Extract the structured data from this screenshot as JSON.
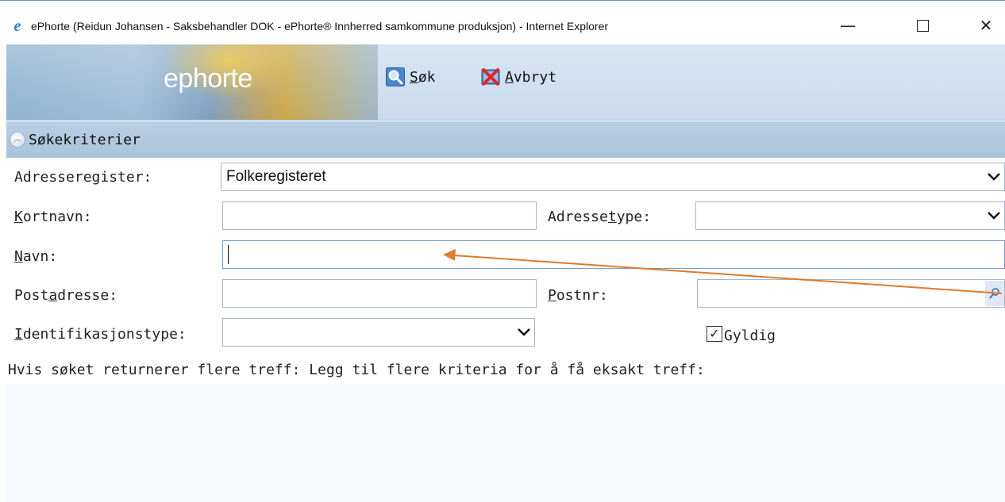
{
  "window": {
    "title": "ePhorte (Reidun Johansen - Saksbehandler DOK - ePhorte® Innherred samkommune produksjon) - Internet Explorer",
    "min_glyph": "—",
    "close_glyph": "✕"
  },
  "header": {
    "logo_text": "ephorte",
    "search_button": {
      "first": "S",
      "rest": "øk"
    },
    "cancel_button": {
      "first": "A",
      "rest": "vbryt"
    }
  },
  "section": {
    "title": "Søkekriterier"
  },
  "form": {
    "adresseregister": {
      "label": "Adresseregister:",
      "value": "Folkeregisteret"
    },
    "kortnavn": {
      "label_u": "K",
      "label_rest": "ortnavn:",
      "value": ""
    },
    "adressetype": {
      "label_pre": "Adresse",
      "label_u": "t",
      "label_rest": "ype:",
      "value": ""
    },
    "navn": {
      "label_u": "N",
      "label_rest": "avn:",
      "value": ""
    },
    "postadresse": {
      "label_pre": "Post",
      "label_u": "a",
      "label_rest": "dresse:",
      "value": ""
    },
    "postnr": {
      "label_u": "P",
      "label_rest": "ostnr:",
      "value": ""
    },
    "identifikasjonstype": {
      "label_u": "I",
      "label_rest": "dentifikasjonstype:",
      "value": ""
    },
    "gyldig": {
      "label": "Gyldig",
      "checked": true,
      "check_glyph": "✓"
    }
  },
  "hint": "Hvis søket returnerer flere treff: Legg til flere kriteria for å få eksakt treff:",
  "colors": {
    "annotation_arrow": "#e07a2c",
    "section_bar": "#b0c8e0",
    "header_bg": "#cfe0f1"
  },
  "icons": {
    "search": "search-magnifier-icon",
    "cancel": "cancel-x-icon",
    "collapse": "collapse-chevron-icon"
  }
}
